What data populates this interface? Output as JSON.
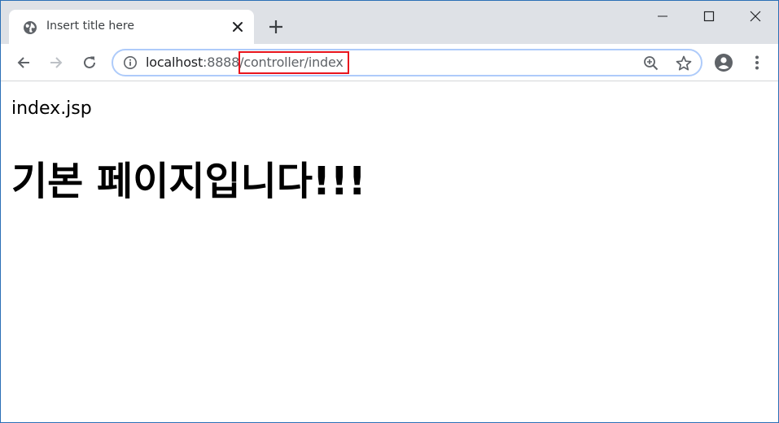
{
  "tab": {
    "title": "Insert title here"
  },
  "window_controls": {
    "minimize_icon": "minimize-icon",
    "maximize_icon": "maximize-icon",
    "close_icon": "close-icon"
  },
  "toolbar": {
    "back_icon": "back-arrow-icon",
    "forward_icon": "forward-arrow-icon",
    "reload_icon": "reload-icon",
    "zoom_icon": "zoom-in-icon",
    "bookmark_icon": "star-icon",
    "profile_icon": "account-icon",
    "menu_icon": "kebab-menu-icon"
  },
  "omnibox": {
    "host": "localhost",
    "port": ":8888",
    "path": "/controller/index",
    "highlight_color": "#e8141d"
  },
  "page": {
    "file_label": "index.jsp",
    "heading": "기본 페이지입니다!!!"
  },
  "colors": {
    "tabstrip_bg": "#dee1e6",
    "omnibox_border": "#aecbfa",
    "window_border": "#2b6fb6"
  }
}
